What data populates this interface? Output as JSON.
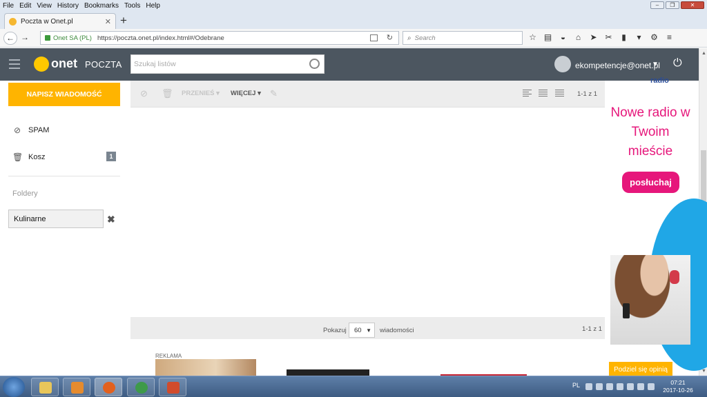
{
  "browser": {
    "menu": [
      "File",
      "Edit",
      "View",
      "History",
      "Bookmarks",
      "Tools",
      "Help"
    ],
    "tab_title": "Poczta w Onet.pl",
    "site_owner": "Onet SA (PL)",
    "url": "https://poczta.onet.pl/index.html#/Odebrane",
    "search_placeholder": "Search"
  },
  "header": {
    "logo_text": "onet",
    "logo_sub": "POCZTA",
    "search_placeholder": "Szukaj listów",
    "user_email": "ekompetencje@onet.pl"
  },
  "sidebar": {
    "compose_label": "NAPISZ WIADOMOŚĆ",
    "items": [
      {
        "label": "SPAM"
      },
      {
        "label": "Kosz",
        "badge": "1"
      }
    ],
    "folders_label": "Foldery",
    "new_folder_value": "Kulinarne"
  },
  "toolbar": {
    "move_label": "PRZENIEŚ",
    "more_label": "WIĘCEJ",
    "count": "1-1 z 1"
  },
  "pager": {
    "show_label": "Pokazuj",
    "per_page": "60",
    "messages_label": "wiadomości",
    "count": "1-1 z 1"
  },
  "ad_bottom": {
    "label": "REKLAMA"
  },
  "ad_right": {
    "brand_fragment": "radio",
    "headline": "Nowe radio w Twoim mieście",
    "button": "posłuchaj"
  },
  "share_button": "Podziel się opinią",
  "taskbar": {
    "language": "PL",
    "time": "07:21",
    "date": "2017-10-26"
  },
  "colors": {
    "accent": "#ffb400",
    "header_bg": "#4c5660",
    "ad_pink": "#e6177b",
    "ad_blue": "#20a7e6"
  }
}
